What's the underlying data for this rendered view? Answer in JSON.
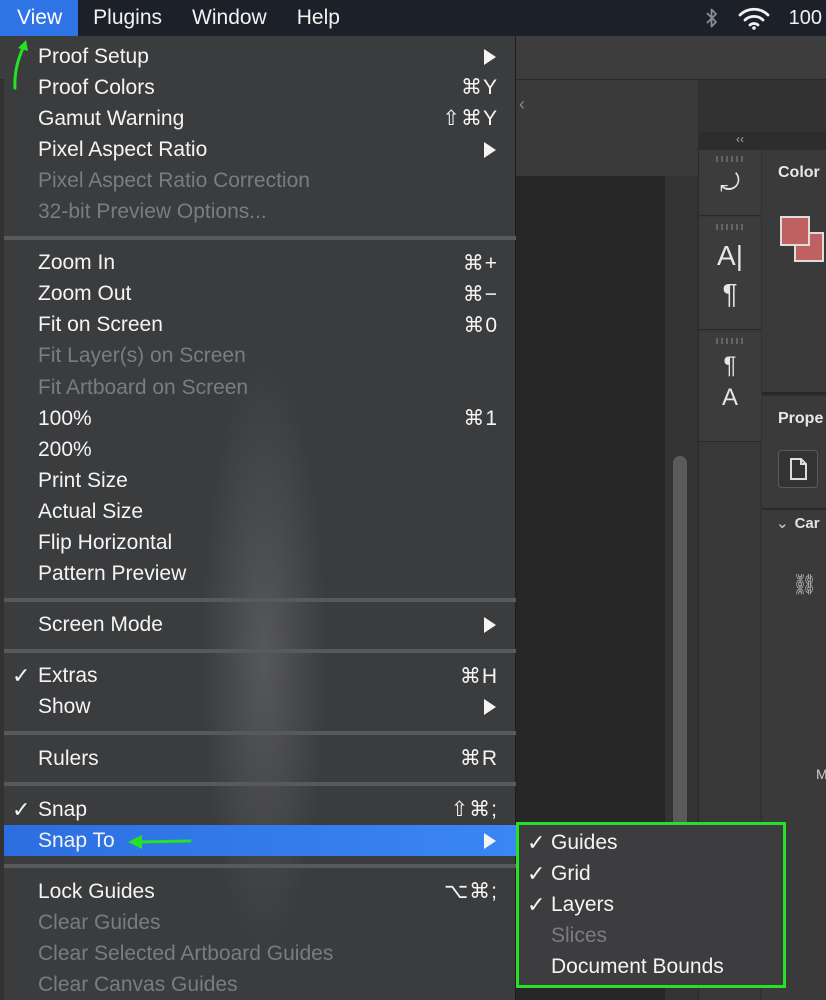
{
  "menubar": {
    "items": [
      "View",
      "Plugins",
      "Window",
      "Help"
    ],
    "active_index": 0,
    "status": {
      "battery": "100"
    }
  },
  "app": {
    "collapse_label": "‹‹",
    "color_panel_title": "Color",
    "properties_panel_title": "Prope",
    "properties_section": "Car",
    "m_label": "M"
  },
  "view_menu": {
    "items": [
      {
        "label": "Proof Setup",
        "shortcut": "",
        "submenu": true,
        "disabled": false,
        "checked": false
      },
      {
        "label": "Proof Colors",
        "shortcut": "⌘Y",
        "submenu": false,
        "disabled": false,
        "checked": false
      },
      {
        "label": "Gamut Warning",
        "shortcut": "⇧⌘Y",
        "submenu": false,
        "disabled": false,
        "checked": false
      },
      {
        "label": "Pixel Aspect Ratio",
        "shortcut": "",
        "submenu": true,
        "disabled": false,
        "checked": false
      },
      {
        "label": "Pixel Aspect Ratio Correction",
        "shortcut": "",
        "submenu": false,
        "disabled": true,
        "checked": false
      },
      {
        "label": "32-bit Preview Options...",
        "shortcut": "",
        "submenu": false,
        "disabled": true,
        "checked": false
      },
      {
        "label": "Zoom In",
        "shortcut": "⌘+",
        "submenu": false,
        "disabled": false,
        "checked": false
      },
      {
        "label": "Zoom Out",
        "shortcut": "⌘−",
        "submenu": false,
        "disabled": false,
        "checked": false
      },
      {
        "label": "Fit on Screen",
        "shortcut": "⌘0",
        "submenu": false,
        "disabled": false,
        "checked": false
      },
      {
        "label": "Fit Layer(s) on Screen",
        "shortcut": "",
        "submenu": false,
        "disabled": true,
        "checked": false
      },
      {
        "label": "Fit Artboard on Screen",
        "shortcut": "",
        "submenu": false,
        "disabled": true,
        "checked": false
      },
      {
        "label": "100%",
        "shortcut": "⌘1",
        "submenu": false,
        "disabled": false,
        "checked": false
      },
      {
        "label": "200%",
        "shortcut": "",
        "submenu": false,
        "disabled": false,
        "checked": false
      },
      {
        "label": "Print Size",
        "shortcut": "",
        "submenu": false,
        "disabled": false,
        "checked": false
      },
      {
        "label": "Actual Size",
        "shortcut": "",
        "submenu": false,
        "disabled": false,
        "checked": false
      },
      {
        "label": "Flip Horizontal",
        "shortcut": "",
        "submenu": false,
        "disabled": false,
        "checked": false
      },
      {
        "label": "Pattern Preview",
        "shortcut": "",
        "submenu": false,
        "disabled": false,
        "checked": false
      },
      {
        "label": "Screen Mode",
        "shortcut": "",
        "submenu": true,
        "disabled": false,
        "checked": false
      },
      {
        "label": "Extras",
        "shortcut": "⌘H",
        "submenu": false,
        "disabled": false,
        "checked": true
      },
      {
        "label": "Show",
        "shortcut": "",
        "submenu": true,
        "disabled": false,
        "checked": false
      },
      {
        "label": "Rulers",
        "shortcut": "⌘R",
        "submenu": false,
        "disabled": false,
        "checked": false
      },
      {
        "label": "Snap",
        "shortcut": "⇧⌘;",
        "submenu": false,
        "disabled": false,
        "checked": true
      },
      {
        "label": "Snap To",
        "shortcut": "",
        "submenu": true,
        "disabled": false,
        "checked": false,
        "highlighted": true
      },
      {
        "label": "Lock Guides",
        "shortcut": "⌥⌘;",
        "submenu": false,
        "disabled": false,
        "checked": false
      },
      {
        "label": "Clear Guides",
        "shortcut": "",
        "submenu": false,
        "disabled": true,
        "checked": false
      },
      {
        "label": "Clear Selected Artboard Guides",
        "shortcut": "",
        "submenu": false,
        "disabled": true,
        "checked": false
      },
      {
        "label": "Clear Canvas Guides",
        "shortcut": "",
        "submenu": false,
        "disabled": true,
        "checked": false
      }
    ]
  },
  "snap_to_submenu": {
    "items": [
      {
        "label": "Guides",
        "checked": true,
        "disabled": false
      },
      {
        "label": "Grid",
        "checked": true,
        "disabled": false
      },
      {
        "label": "Layers",
        "checked": true,
        "disabled": false
      },
      {
        "label": "Slices",
        "checked": false,
        "disabled": true
      },
      {
        "label": "Document Bounds",
        "checked": false,
        "disabled": false
      }
    ]
  },
  "colors": {
    "menubar_bg": "#1c2029",
    "active_menu": "#2f74e6",
    "highlight": "#3a86f5",
    "annotation_green": "#27e127",
    "swatch": "#c06060"
  }
}
